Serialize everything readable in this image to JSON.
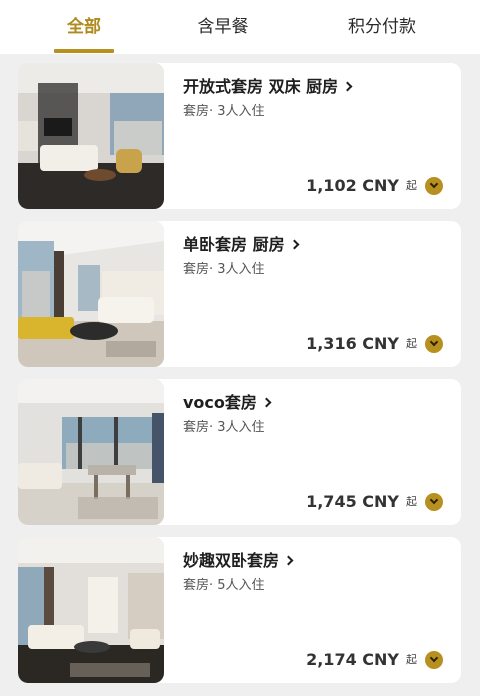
{
  "tabs": [
    {
      "label": "全部",
      "active": true
    },
    {
      "label": "含早餐",
      "active": false
    },
    {
      "label": "积分付款",
      "active": false
    }
  ],
  "colors": {
    "accent": "#b8901f",
    "card_bg": "#ffffff",
    "page_bg": "#efefef"
  },
  "rooms": [
    {
      "name": "开放式套房 双床 厨房",
      "meta": "套房· 3人入住",
      "price": "1,102 CNY",
      "price_suffix": "起",
      "image": "living-room-photo"
    },
    {
      "name": "单卧套房 厨房",
      "meta": "套房· 3人入住",
      "price": "1,316 CNY",
      "price_suffix": "起",
      "image": "living-room-photo"
    },
    {
      "name": "voco套房",
      "meta": "套房· 3人入住",
      "price": "1,745 CNY",
      "price_suffix": "起",
      "image": "dining-room-photo"
    },
    {
      "name": "妙趣双卧套房",
      "meta": "套房· 5人入住",
      "price": "2,174 CNY",
      "price_suffix": "起",
      "image": "living-room-photo"
    }
  ]
}
